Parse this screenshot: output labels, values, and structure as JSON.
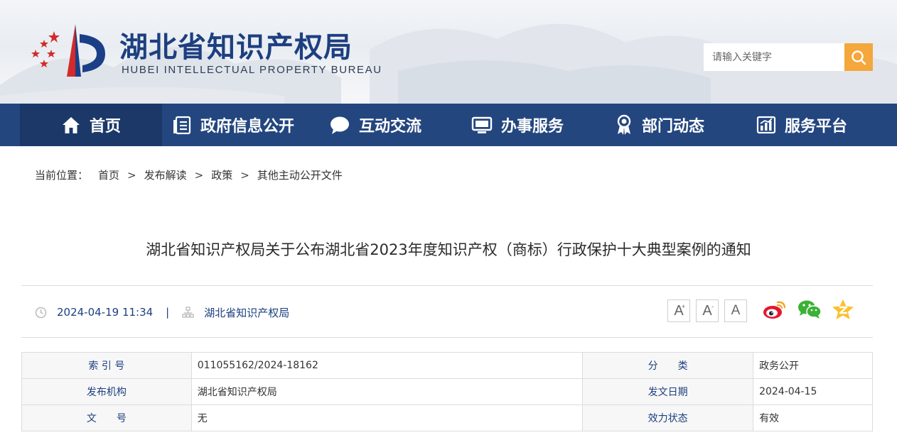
{
  "header": {
    "title": "湖北省知识产权局",
    "subtitle": "HUBEI INTELLECTUAL PROPERTY BUREAU",
    "logo_icon": "hubei-ipb-logo-icon"
  },
  "search": {
    "placeholder": "请输入关键字",
    "button_icon": "search-icon",
    "accent": "#f4a73b"
  },
  "nav": {
    "bg_color": "#23467f",
    "items": [
      {
        "label": "首页",
        "icon": "home-icon",
        "active": true
      },
      {
        "label": "政府信息公开",
        "icon": "document-list-icon"
      },
      {
        "label": "互动交流",
        "icon": "chat-bubble-icon"
      },
      {
        "label": "办事服务",
        "icon": "monitor-icon"
      },
      {
        "label": "部门动态",
        "icon": "award-icon"
      },
      {
        "label": "服务平台",
        "icon": "chart-icon"
      }
    ]
  },
  "breadcrumb": {
    "label": "当前位置：",
    "items": [
      "首页",
      "发布解读",
      "政策",
      "其他主动公开文件"
    ],
    "separator": ">"
  },
  "article": {
    "title": "湖北省知识产权局关于公布湖北省2023年度知识产权（商标）行政保护十大典型案例的通知",
    "date": "2024-04-19 11:34",
    "divider": "|",
    "source": "湖北省知识产权局"
  },
  "font_size_buttons": [
    "A",
    "A",
    "A"
  ],
  "font_size_marks": [
    "+",
    "-"
  ],
  "share": [
    "weibo-icon",
    "wechat-icon",
    "qzone-icon"
  ],
  "info_table": [
    [
      {
        "label": "索 引 号",
        "value": "011055162/2024-18162"
      },
      {
        "label": "分　　类",
        "value": "政务公开"
      }
    ],
    [
      {
        "label": "发布机构",
        "value": "湖北省知识产权局"
      },
      {
        "label": "发文日期",
        "value": "2024-04-15"
      }
    ],
    [
      {
        "label": "文　　号",
        "value": "无"
      },
      {
        "label": "效力状态",
        "value": "有效"
      }
    ]
  ]
}
